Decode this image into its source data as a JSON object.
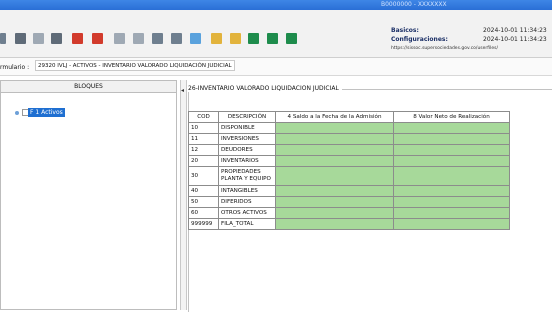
{
  "window": {
    "title": "B0000000 - XXXXXXX"
  },
  "toolbar": {
    "icons": [
      "left-icon",
      "folder-icon",
      "save-icon",
      "print-icon",
      "flag-icon",
      "send-icon",
      "filter-icon",
      "settings-icon",
      "grid-icon",
      "grid-alt-icon",
      "chart-icon",
      "table-icon",
      "table-alt-icon",
      "table-add-icon",
      "table-remove-icon",
      "spreadsheet-icon"
    ]
  },
  "info": {
    "basicos_label": "Basicos:",
    "basicos_value": "2024-10-01 11:34:23",
    "config_label": "Configuraciones:",
    "config_value": "2024-10-01 11:34:23",
    "url": "https://sissoc.supersociedades.gov.co/userfiles/"
  },
  "form": {
    "label": "rmulario :",
    "value": "29320 IVLJ - ACTIVOS - INVENTARIO VALORADO LIQUIDACIÓN JUDICIAL"
  },
  "left_panel": {
    "header": "BLOQUES",
    "item": "F 1 Activos"
  },
  "right_panel": {
    "title": "26-INVENTARIO VALORADO LIQUIDACION JUDICIAL",
    "columns": [
      "COD",
      "DESCRIPCIÓN",
      "4 Saldo a la Fecha de la Admisión",
      "8 Valor Neto de Realización"
    ],
    "rows": [
      {
        "cod": "10",
        "desc": "DISPONIBLE"
      },
      {
        "cod": "11",
        "desc": "INVERSIONES"
      },
      {
        "cod": "12",
        "desc": "DEUDORES"
      },
      {
        "cod": "20",
        "desc": "INVENTARIOS"
      },
      {
        "cod": "30",
        "desc": "PROPIEDADES PLANTA Y EQUIPO"
      },
      {
        "cod": "40",
        "desc": "INTANGIBLES"
      },
      {
        "cod": "50",
        "desc": "DIFERIDOS"
      },
      {
        "cod": "60",
        "desc": "OTROS ACTIVOS"
      },
      {
        "cod": "999999",
        "desc": "FILA_TOTAL"
      }
    ]
  },
  "colors": {
    "cell_green": "#a7d99a",
    "title_blue": "#2a6fd6"
  }
}
